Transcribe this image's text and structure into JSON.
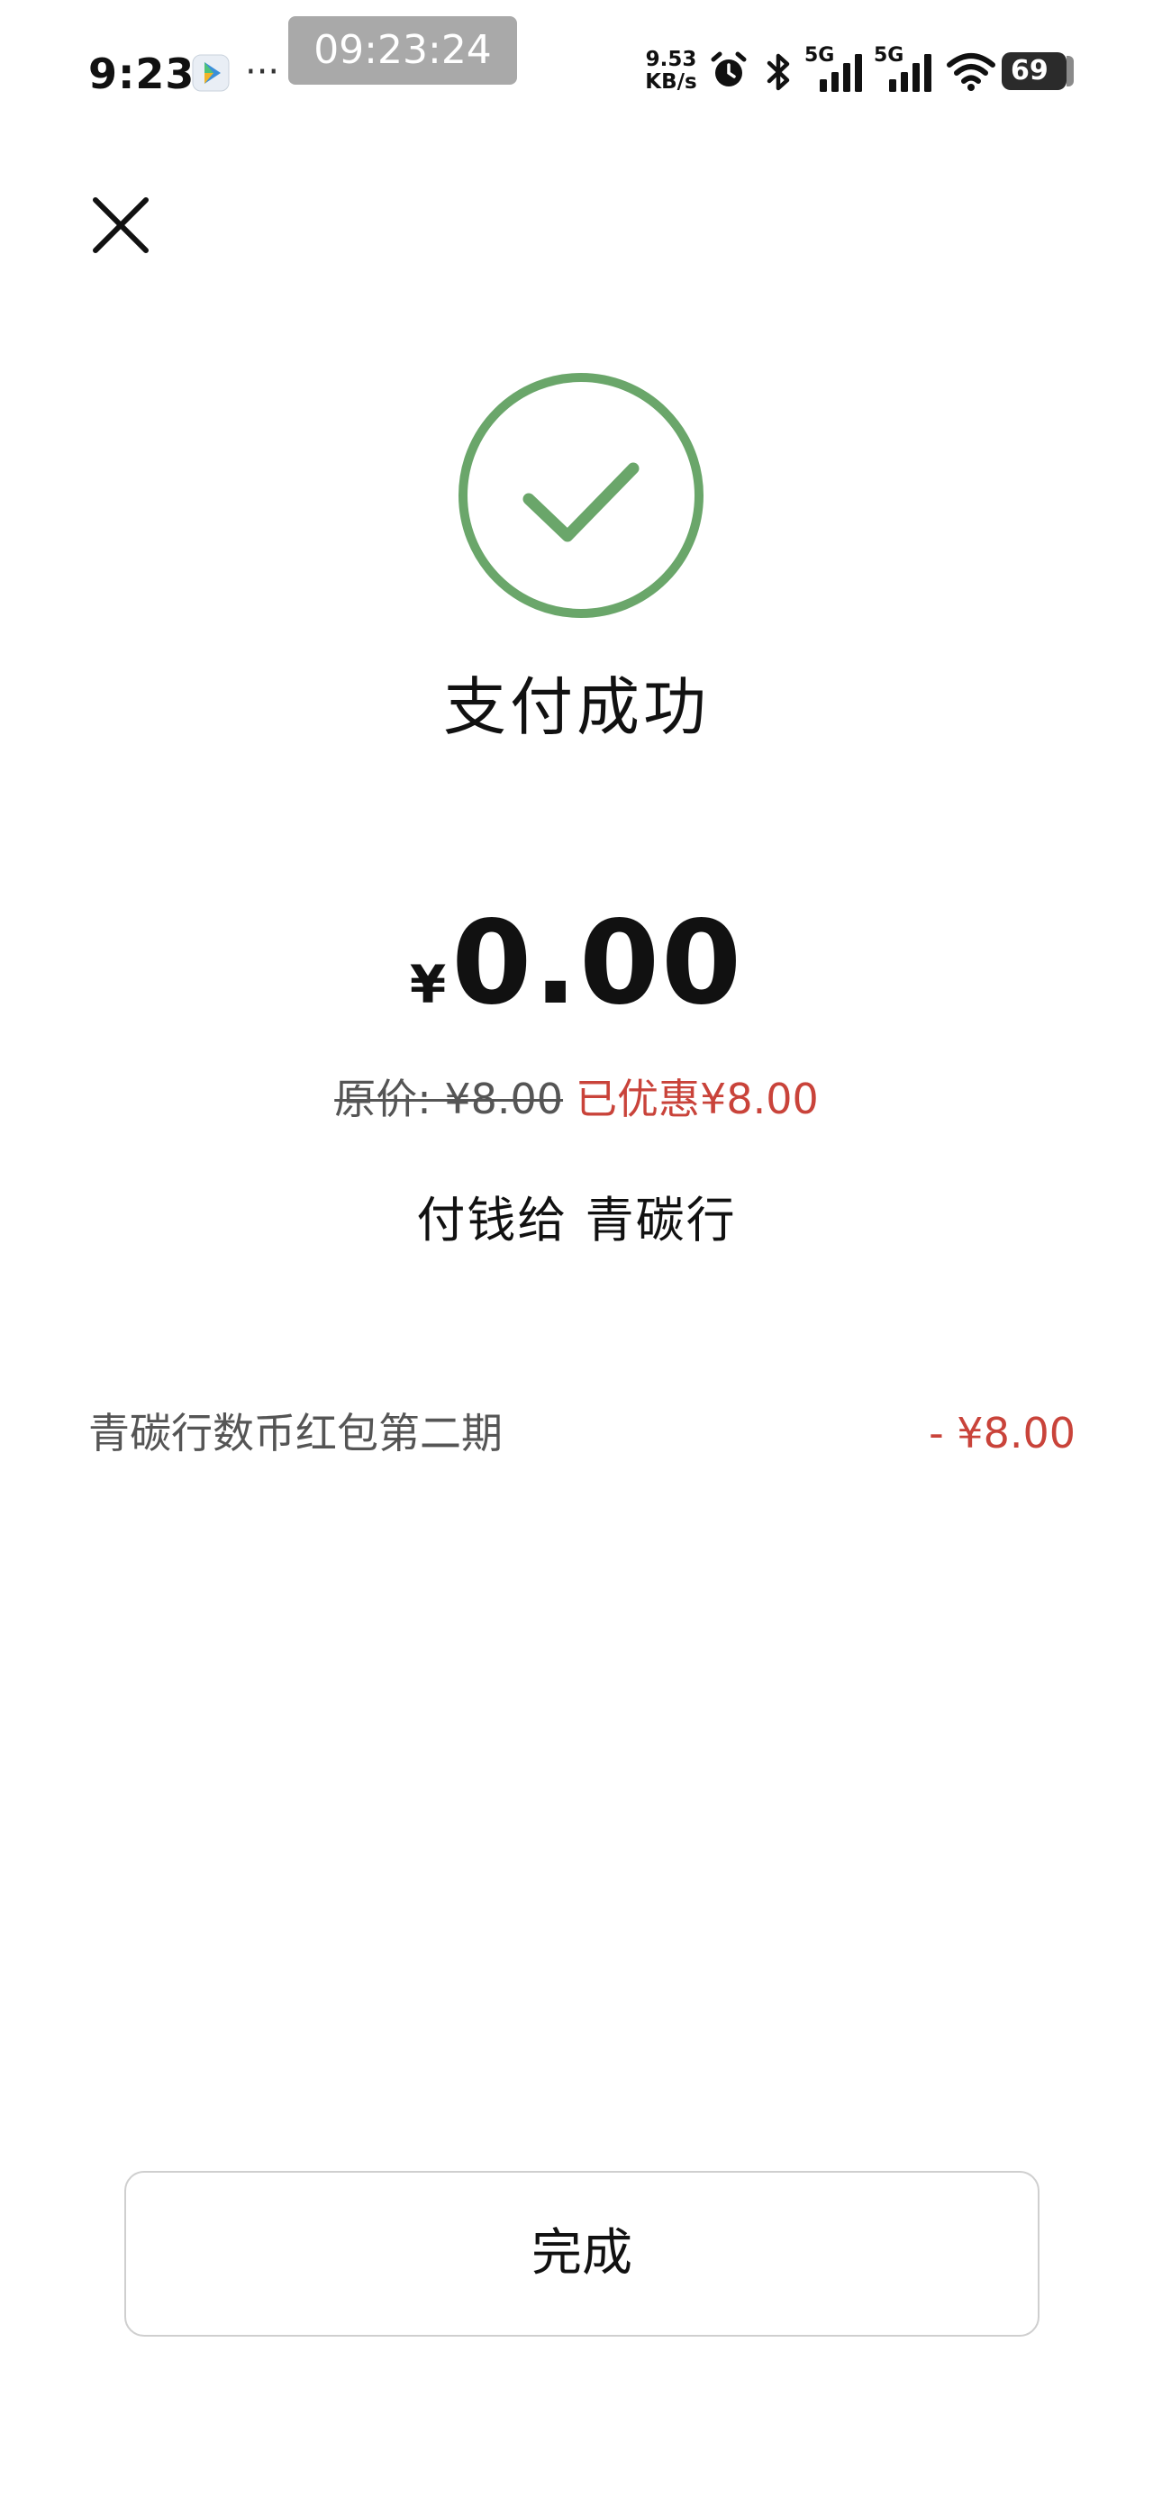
{
  "status_bar": {
    "time": "9:23",
    "more": "···",
    "recording_timer": "09:23:24",
    "net_speed_value": "9.53",
    "net_speed_unit": "KB/s",
    "signal_1_label": "5G",
    "signal_2_label": "5G",
    "battery_level": "69",
    "icons": [
      "app-icon",
      "alarm-icon",
      "bluetooth-icon",
      "signal-icon",
      "signal-icon",
      "wifi-icon",
      "battery-icon"
    ]
  },
  "header": {
    "close_icon": "close-icon"
  },
  "result": {
    "icon": "check-circle-icon",
    "title": "支付成功",
    "currency_symbol": "¥",
    "amount": "0.00",
    "original_price_text": "原价: ¥8.00",
    "discount_text": "已优惠¥8.00",
    "payee_text": "付钱给 青碳行"
  },
  "discount_detail": {
    "label": "青碳行数币红包第二期",
    "amount": "- ¥8.00"
  },
  "actions": {
    "done_label": "完成"
  },
  "colors": {
    "success_green": "#6aa66a",
    "discount_red": "#c9433a",
    "text_primary": "#111111",
    "text_secondary": "#555555",
    "button_border": "#cfcfcf"
  }
}
